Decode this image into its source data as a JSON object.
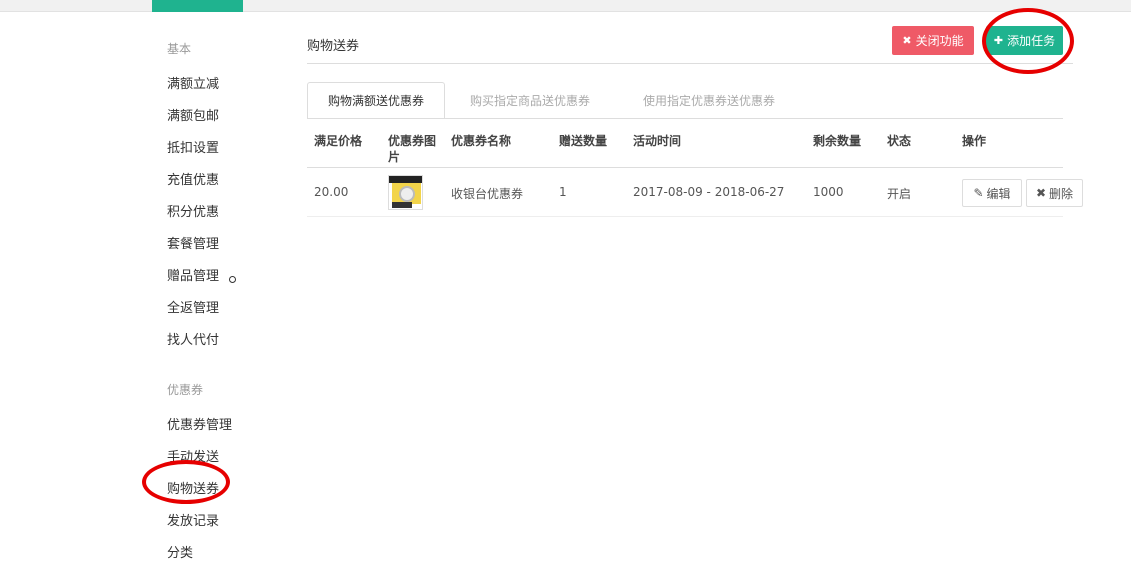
{
  "sidebar": {
    "group1_title": "基本",
    "group1_items": [
      "满额立减",
      "满额包邮",
      "抵扣设置",
      "充值优惠",
      "积分优惠",
      "套餐管理",
      "赠品管理",
      "全返管理",
      "找人代付"
    ],
    "group2_title": "优惠券",
    "group2_items": [
      "优惠券管理",
      "手动发送",
      "购物送券",
      "发放记录",
      "分类"
    ]
  },
  "main": {
    "title": "购物送券",
    "close_button": "关闭功能",
    "add_button": "添加任务",
    "tabs": [
      "购物满额送优惠券",
      "购买指定商品送优惠券",
      "使用指定优惠券送优惠券"
    ],
    "columns": [
      "满足价格",
      "优惠券图片",
      "优惠券名称",
      "赠送数量",
      "活动时间",
      "剩余数量",
      "状态",
      "操作"
    ],
    "rows": [
      {
        "price": "20.00",
        "name": "收银台优惠券",
        "qty": "1",
        "time": "2017-08-09 - 2018-06-27",
        "remaining": "1000",
        "status": "开启",
        "edit": "编辑",
        "delete": "删除"
      }
    ]
  },
  "colors": {
    "accent": "#1fb38f",
    "danger": "#ef5a67",
    "annotation": "#e60000"
  }
}
